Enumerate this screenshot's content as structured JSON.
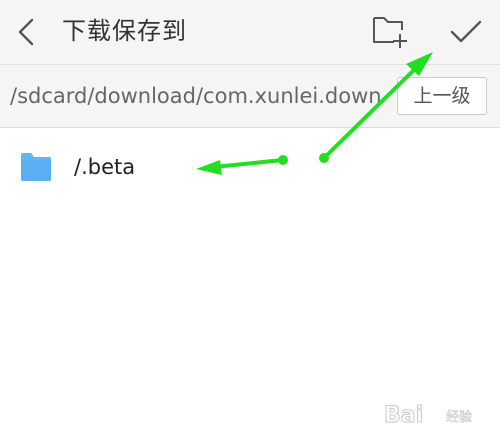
{
  "header": {
    "title": "下载保存到"
  },
  "path_bar": {
    "path": "/sdcard/download/com.xunlei.down...",
    "up_button_label": "上一级"
  },
  "list": {
    "items": [
      {
        "label": "/.beta",
        "icon": "folder-icon"
      }
    ]
  },
  "annotations": {
    "arrow_color": "#22dd22"
  },
  "watermark": {
    "brand": "Bai",
    "sub": "经验"
  },
  "colors": {
    "header_bg": "#f5f5f5",
    "folder_icon": "#64b5f6",
    "icon_stroke": "#555555"
  }
}
